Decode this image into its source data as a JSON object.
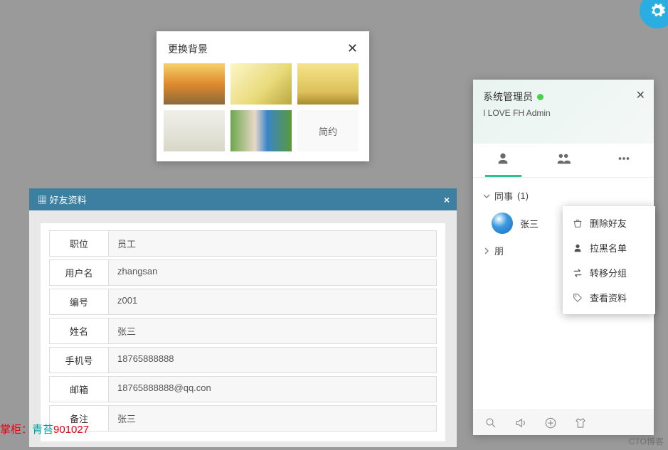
{
  "gear": {
    "name": "settings-gear-icon"
  },
  "bgDialog": {
    "title": "更换背景",
    "simpleLabel": "简约"
  },
  "profile": {
    "headerTitle": "好友资料",
    "rows": [
      {
        "label": "职位",
        "value": "员工"
      },
      {
        "label": "用户名",
        "value": "zhangsan"
      },
      {
        "label": "编号",
        "value": "z001"
      },
      {
        "label": "姓名",
        "value": "张三"
      },
      {
        "label": "手机号",
        "value": "18765888888"
      },
      {
        "label": "邮箱",
        "value": "18765888888@qq.con"
      },
      {
        "label": "备注",
        "value": "张三"
      }
    ],
    "ownerPrefix": "掌柜：",
    "ownerName": "青苔",
    "ownerId": "901027"
  },
  "im": {
    "adminName": "系统管理员",
    "motto": "I LOVE FH Admin",
    "groups": [
      {
        "name": "同事",
        "count": "(1)",
        "expanded": true,
        "contacts": [
          {
            "name": "张三"
          }
        ]
      },
      {
        "name": "朋",
        "count": "",
        "expanded": false,
        "contacts": []
      }
    ]
  },
  "ctx": {
    "items": [
      {
        "icon": "trash-icon",
        "label": "删除好友"
      },
      {
        "icon": "person-icon",
        "label": "拉黑名单"
      },
      {
        "icon": "transfer-icon",
        "label": "转移分组"
      },
      {
        "icon": "tag-icon",
        "label": "查看资料"
      }
    ]
  },
  "watermark": {
    "text": "CTO博客"
  }
}
